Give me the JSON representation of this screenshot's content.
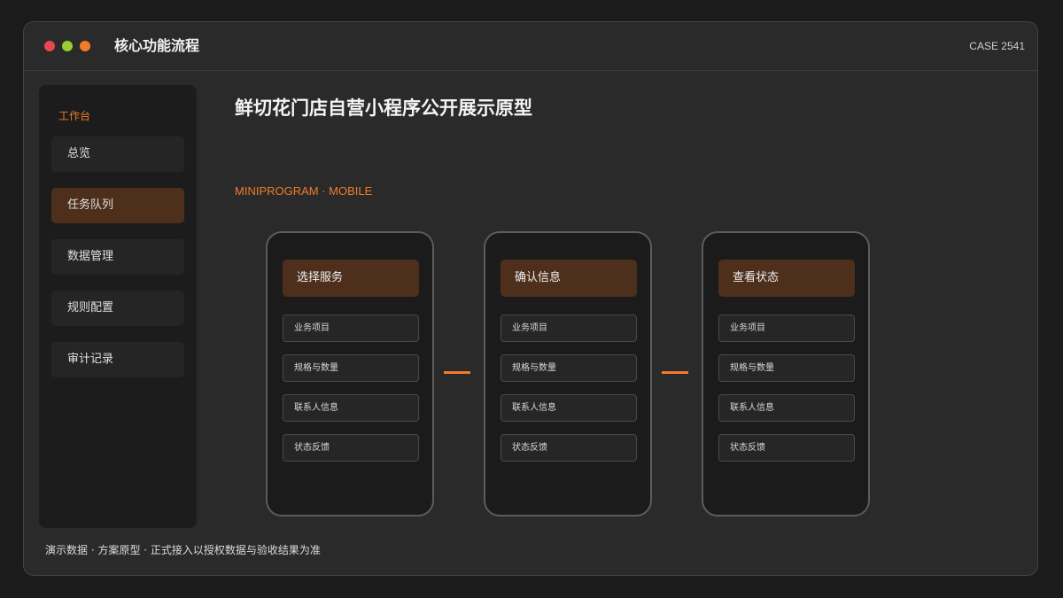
{
  "window": {
    "title": "核心功能流程",
    "case_label": "CASE 2541"
  },
  "sidebar": {
    "section_label": "工作台",
    "items": [
      {
        "label": "总览",
        "active": false
      },
      {
        "label": "任务队列",
        "active": true
      },
      {
        "label": "数据管理",
        "active": false
      },
      {
        "label": "规则配置",
        "active": false
      },
      {
        "label": "审计记录",
        "active": false
      }
    ]
  },
  "main": {
    "title": "鲜切花门店自营小程序公开展示原型",
    "subtitle": "MINIPROGRAM · MOBILE",
    "phones": [
      {
        "header": "选择服务",
        "rows": [
          "业务项目",
          "规格与数量",
          "联系人信息",
          "状态反馈"
        ]
      },
      {
        "header": "确认信息",
        "rows": [
          "业务项目",
          "规格与数量",
          "联系人信息",
          "状态反馈"
        ]
      },
      {
        "header": "查看状态",
        "rows": [
          "业务项目",
          "规格与数量",
          "联系人信息",
          "状态反馈"
        ]
      }
    ]
  },
  "footer": {
    "note": "演示数据 · 方案原型 · 正式接入以授权数据与验收结果为准"
  },
  "colors": {
    "accent": "#f07c2a",
    "active_fill": "#4e2f1c",
    "background": "#1b1b1b",
    "panel": "#2a2a2a"
  }
}
